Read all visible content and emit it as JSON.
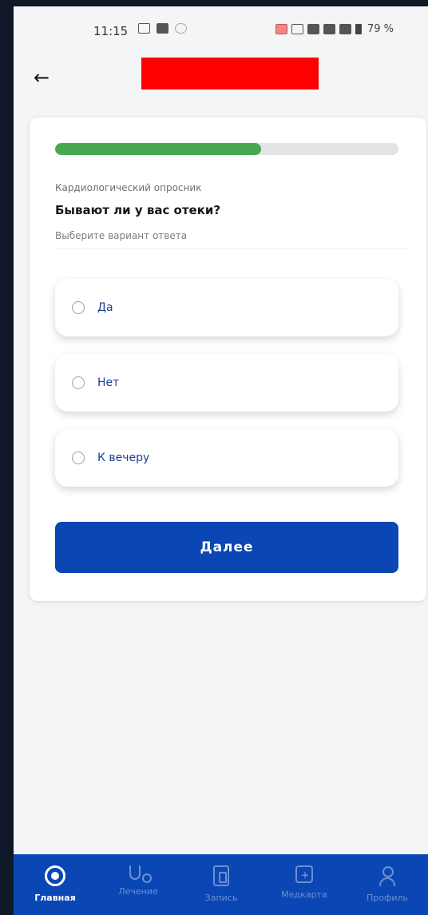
{
  "status_bar": {
    "time": "11:15",
    "battery": "79 %",
    "icons_left": [
      "calendar-icon",
      "video-icon",
      "screen-record-icon"
    ],
    "icons_right": [
      "notification-icon",
      "sim-icon",
      "wifi-icon",
      "signal-icon",
      "signal-icon-2",
      "battery-icon"
    ]
  },
  "app_bar": {
    "back_icon": "arrow-left-icon",
    "title_redacted": true
  },
  "survey": {
    "progress": 0.6,
    "name": "Кардиологический опросник",
    "question": "Бывают ли у вас отеки?",
    "hint": "Выберите вариант ответа",
    "options": [
      {
        "label": "Да"
      },
      {
        "label": "Нет"
      },
      {
        "label": "К вечеру"
      }
    ],
    "next_label": "Далее"
  },
  "bottom_nav": {
    "items": [
      {
        "label": "Главная",
        "icon": "home-icon",
        "active": true
      },
      {
        "label": "Лечение",
        "icon": "stethoscope-icon",
        "active": false
      },
      {
        "label": "Запись",
        "icon": "clipboard-icon",
        "active": false
      },
      {
        "label": "Медкарта",
        "icon": "medical-card-icon",
        "active": false
      },
      {
        "label": "Профиль",
        "icon": "profile-icon",
        "active": false
      }
    ]
  },
  "colors": {
    "accent": "#0b47b4",
    "progress": "#47a84f",
    "redaction": "#ff0000"
  }
}
